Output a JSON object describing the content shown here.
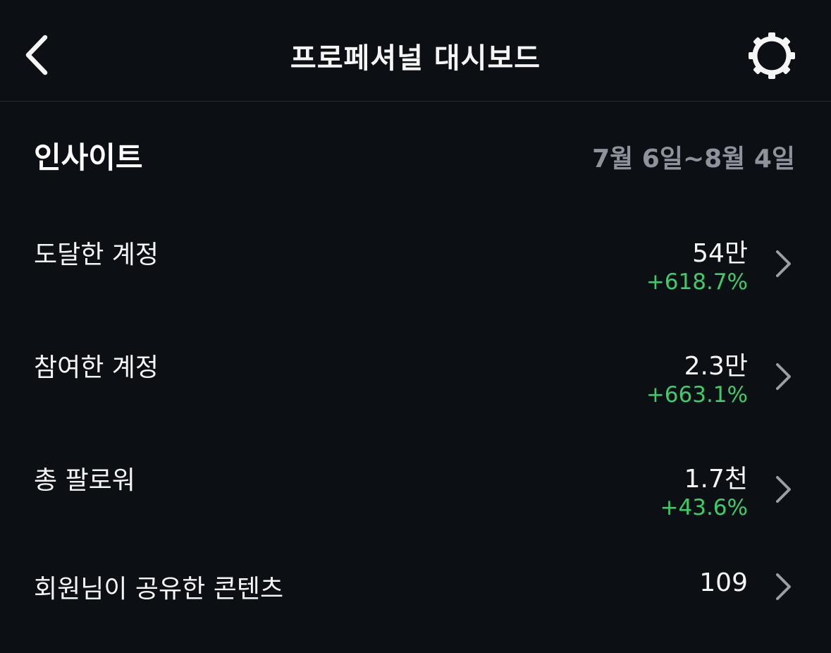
{
  "header": {
    "title": "프로페셔널 대시보드",
    "back_icon": "chevron-left-icon",
    "settings_icon": "gear-icon"
  },
  "insights": {
    "title": "인사이트",
    "date_range": "7월 6일~8월 4일",
    "rows": [
      {
        "label": "도달한 계정",
        "value": "54만",
        "change": "+618.7%"
      },
      {
        "label": "참여한 계정",
        "value": "2.3만",
        "change": "+663.1%"
      },
      {
        "label": "총 팔로워",
        "value": "1.7천",
        "change": "+43.6%"
      },
      {
        "label": "회원님이 공유한 콘텐츠",
        "value": "109"
      }
    ]
  },
  "colors": {
    "background": "#0c0f14",
    "text": "#f5f5f5",
    "muted": "#8e939b",
    "positive": "#3ccd68",
    "divider": "#262a31"
  }
}
